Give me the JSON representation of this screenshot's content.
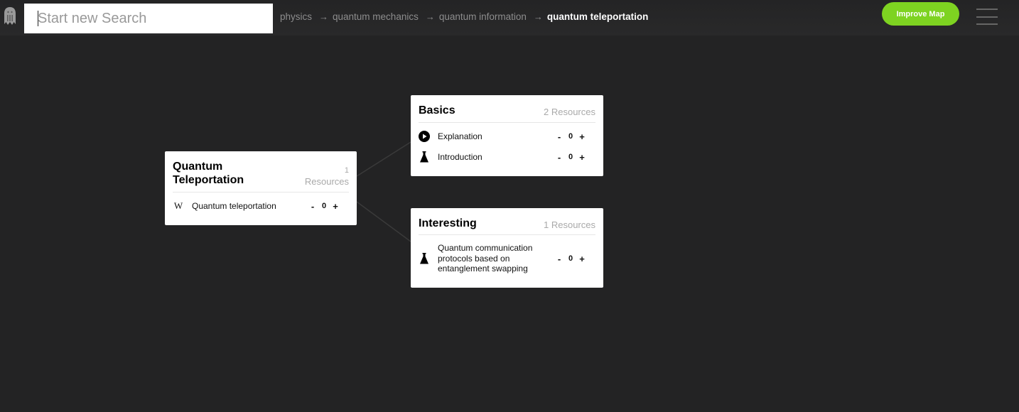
{
  "app": {
    "logo_icon": "ghost-logo-icon",
    "accent_color": "#7ed321"
  },
  "search": {
    "value": "",
    "placeholder": "Start new Search"
  },
  "breadcrumb": {
    "items": [
      "physics",
      "quantum mechanics",
      "quantum information",
      "quantum teleportation"
    ],
    "separator": "→"
  },
  "header": {
    "improve_label": "Improve Map",
    "menu_icon": "hamburger-menu-icon"
  },
  "nodes": [
    {
      "title": "Quantum Teleportation",
      "count_num": "1",
      "count_word": "Resources",
      "resources": [
        {
          "icon": "wikipedia-icon",
          "label": "Quantum teleportation",
          "minus": "-",
          "votes": "0",
          "plus": "+"
        }
      ]
    },
    {
      "title": "Basics",
      "count": "2 Resources",
      "resources": [
        {
          "icon": "play-icon",
          "label": "Explanation",
          "minus": "-",
          "votes": "0",
          "plus": "+"
        },
        {
          "icon": "flask-icon",
          "label": "Introduction",
          "minus": "-",
          "votes": "0",
          "plus": "+"
        }
      ]
    },
    {
      "title": "Interesting",
      "count": "1 Resources",
      "resources": [
        {
          "icon": "flask-icon",
          "label": "Quantum communication protocols based on entanglement swapping",
          "minus": "-",
          "votes": "0",
          "plus": "+"
        }
      ]
    }
  ]
}
